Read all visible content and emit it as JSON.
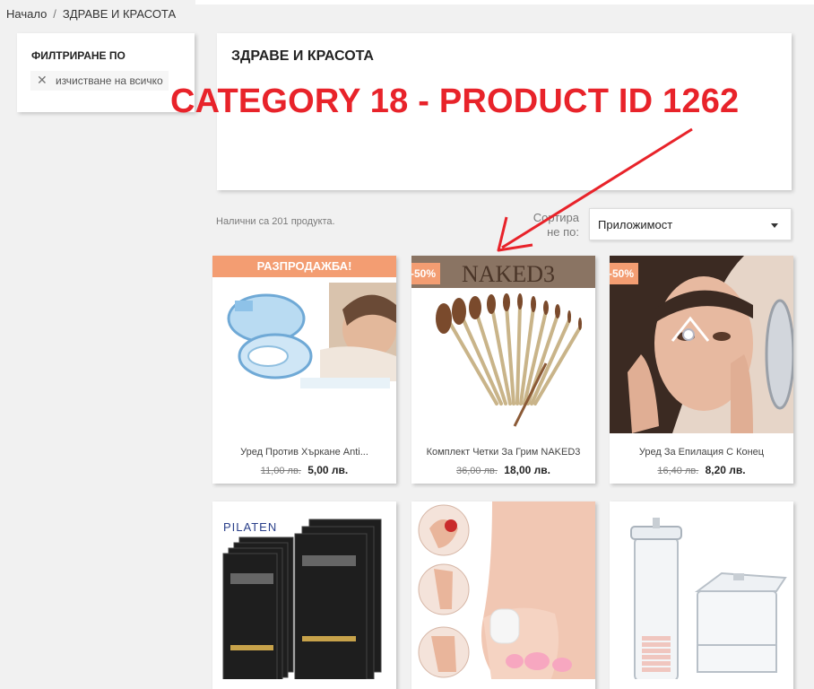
{
  "breadcrumb": {
    "home": "Начало",
    "separator": "/",
    "current": "ЗДРАВЕ И КРАСОТА"
  },
  "filters": {
    "title": "ФИЛТРИРАНЕ ПО",
    "clear_all": "изчистване на всичко",
    "clear_icon": "close-icon"
  },
  "category": {
    "title": "ЗДРАВЕ И КРАСОТА"
  },
  "annotation": {
    "text": "CATEGORY 18 - PRODUCT ID 1262",
    "color": "#e8232a"
  },
  "listing": {
    "count_text": "Налични са 201 продукта.",
    "sort_label_line1": "Сортира",
    "sort_label_line2": "не по:",
    "sort_value": "Приложимост"
  },
  "colors": {
    "accent": "#f39d72",
    "background": "#f1f1f1"
  },
  "products": [
    {
      "name": "Уред Против Хъркане Anti...",
      "old_price": "11,00 лв.",
      "price": "5,00 лв.",
      "flag": "РАЗПРОДАЖБА!"
    },
    {
      "name": "Комплект Четки За Грим NAKED3",
      "old_price": "36,00 лв.",
      "price": "18,00 лв.",
      "flag": "-50%",
      "image_text": "NAKED3"
    },
    {
      "name": "Уред За Епилация С Конец",
      "old_price": "16,40 лв.",
      "price": "8,20 лв.",
      "flag": "-50%"
    },
    {
      "name": "",
      "image_text": "PILATEN"
    },
    {
      "name": ""
    },
    {
      "name": ""
    }
  ]
}
